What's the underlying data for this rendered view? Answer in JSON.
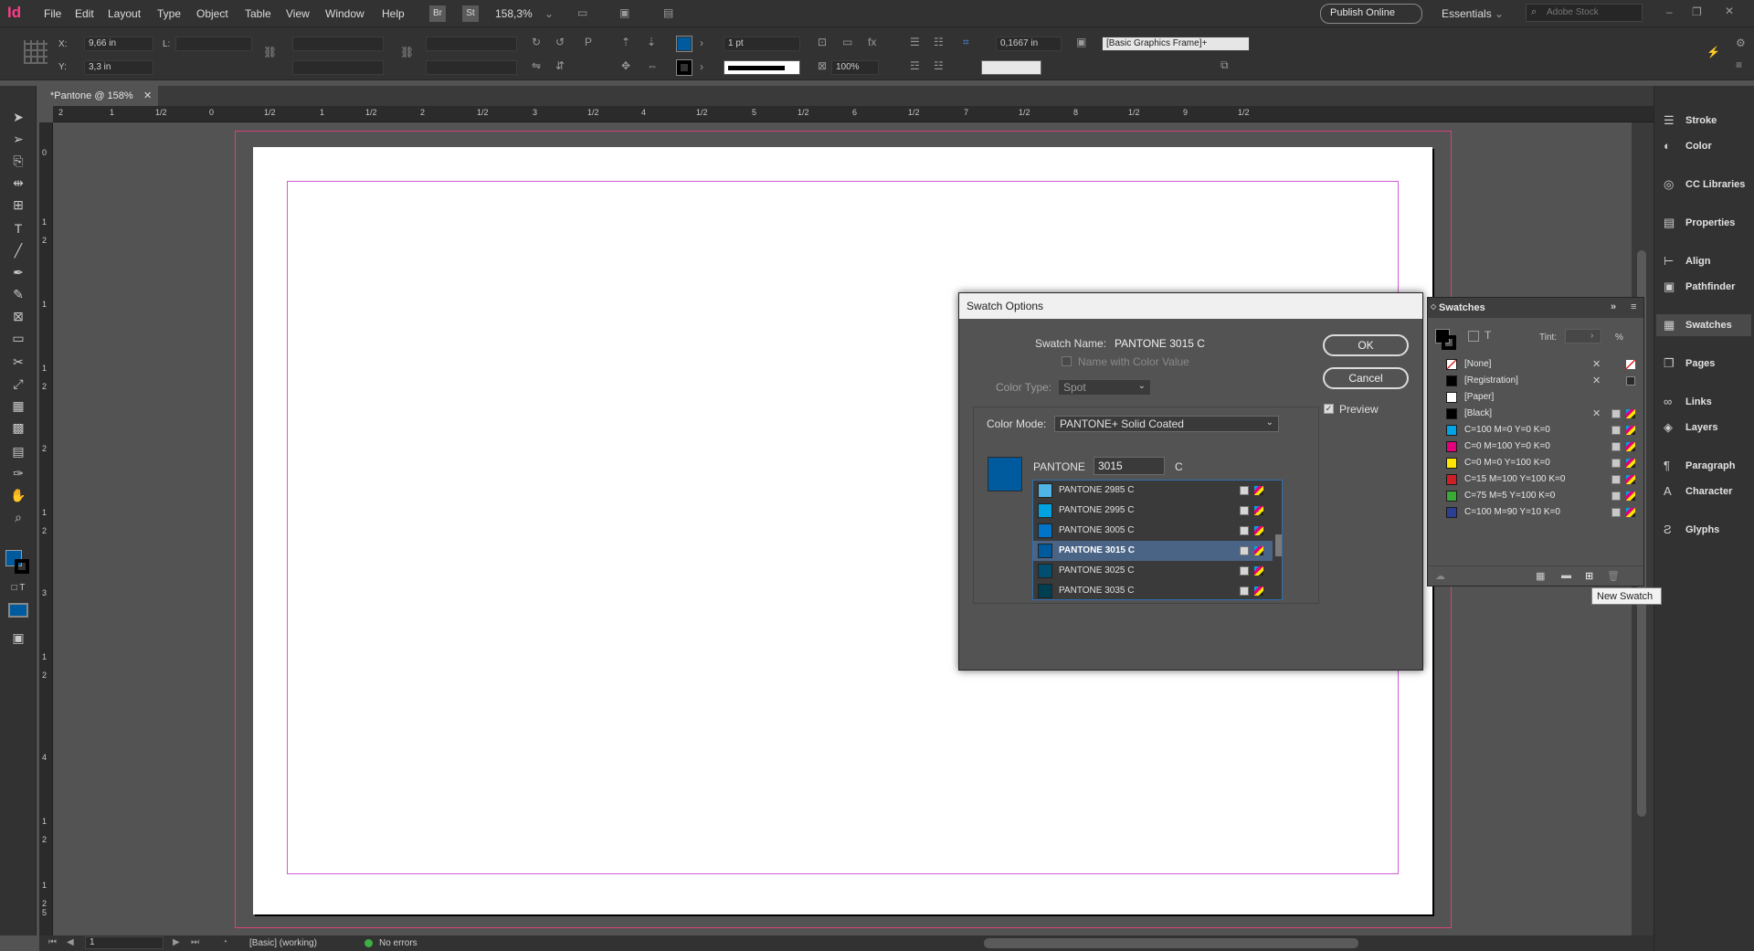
{
  "app": {
    "logo": "Id"
  },
  "menu": [
    "File",
    "Edit",
    "Layout",
    "Type",
    "Object",
    "Table",
    "View",
    "Window",
    "Help"
  ],
  "menubar": {
    "br": "Br",
    "st": "St",
    "zoom": "158,3%",
    "publish_online": "Publish Online",
    "workspace": "Essentials",
    "search_placeholder": "Adobe Stock"
  },
  "control": {
    "x_label": "X:",
    "x_value": "9,66 in",
    "y_label": "Y:",
    "y_value": "3,3 in",
    "l_label": "L:",
    "stroke_weight": "1 pt",
    "scale": "100%",
    "offset": "0,1667 in",
    "object_style": "[Basic Graphics Frame]+",
    "fill_color": "#005b9e",
    "stroke_color": "#000000"
  },
  "document_tab": {
    "title": "*Pantone @ 158%"
  },
  "hruler_labels": [
    "2",
    "1",
    "1/2",
    "0",
    "1/2",
    "1",
    "1/2",
    "2",
    "1/2",
    "3",
    "1/2",
    "4",
    "1/2",
    "5",
    "1/2",
    "6",
    "1/2",
    "7",
    "1/2",
    "8",
    "1/2",
    "9",
    "1/2"
  ],
  "vruler_labels": [
    "0",
    "1",
    "2",
    "1",
    "1",
    "2",
    "2",
    "1",
    "2",
    "3",
    "1",
    "2",
    "4",
    "1",
    "2",
    "5",
    "1",
    "2"
  ],
  "right_panels": [
    {
      "label": "Stroke",
      "icon": "stroke-icon",
      "glyph": "☰"
    },
    {
      "label": "Color",
      "icon": "color-icon",
      "glyph": "◐"
    },
    {
      "label": "CC Libraries",
      "icon": "cc-libraries-icon",
      "glyph": "◎"
    },
    {
      "label": "Properties",
      "icon": "properties-icon",
      "glyph": "▤"
    },
    {
      "label": "Align",
      "icon": "align-icon",
      "glyph": "⊢"
    },
    {
      "label": "Pathfinder",
      "icon": "pathfinder-icon",
      "glyph": "▣"
    },
    {
      "label": "Swatches",
      "icon": "swatches-icon",
      "glyph": "▦"
    },
    {
      "label": "Pages",
      "icon": "pages-icon",
      "glyph": "❐"
    },
    {
      "label": "Links",
      "icon": "links-icon",
      "glyph": "∞"
    },
    {
      "label": "Layers",
      "icon": "layers-icon",
      "glyph": "◈"
    },
    {
      "label": "Paragraph",
      "icon": "paragraph-icon",
      "glyph": "¶"
    },
    {
      "label": "Character",
      "icon": "character-icon",
      "glyph": "A"
    },
    {
      "label": "Glyphs",
      "icon": "glyphs-icon",
      "glyph": "Ƨ"
    }
  ],
  "dialog": {
    "title": "Swatch Options",
    "swatch_name_label": "Swatch Name:",
    "swatch_name_value": "PANTONE 3015 C",
    "name_with_color_value": "Name with Color Value",
    "color_type_label": "Color Type:",
    "color_type_value": "Spot",
    "color_mode_label": "Color Mode:",
    "color_mode_value": "PANTONE+ Solid Coated",
    "pantone_label": "PANTONE",
    "pantone_input": "3015",
    "pantone_suffix": "C",
    "preview_color": "#005b9e",
    "ok": "OK",
    "cancel": "Cancel",
    "preview": "Preview",
    "pantone_list": [
      {
        "name": "PANTONE 2985 C",
        "color": "#4fb5e6"
      },
      {
        "name": "PANTONE 2995 C",
        "color": "#00a3e0"
      },
      {
        "name": "PANTONE 3005 C",
        "color": "#0074c8"
      },
      {
        "name": "PANTONE 3015 C",
        "color": "#005b9e"
      },
      {
        "name": "PANTONE 3025 C",
        "color": "#004f71"
      },
      {
        "name": "PANTONE 3035 C",
        "color": "#003e51"
      }
    ]
  },
  "swatches": {
    "title": "Swatches",
    "tint_label": "Tint:",
    "tint_unit": "%",
    "items": [
      {
        "name": "[None]",
        "color": "#ffffff"
      },
      {
        "name": "[Registration]",
        "color": "#000000"
      },
      {
        "name": "[Paper]",
        "color": "#ffffff"
      },
      {
        "name": "[Black]",
        "color": "#000000"
      },
      {
        "name": "C=100 M=0 Y=0 K=0",
        "color": "#00a4e4"
      },
      {
        "name": "C=0 M=100 Y=0 K=0",
        "color": "#e4007c"
      },
      {
        "name": "C=0 M=0 Y=100 K=0",
        "color": "#ffe600"
      },
      {
        "name": "C=15 M=100 Y=100 K=0",
        "color": "#cc1f26"
      },
      {
        "name": "C=75 M=5 Y=100 K=0",
        "color": "#3aa935"
      },
      {
        "name": "C=100 M=90 Y=10 K=0",
        "color": "#2a3f93"
      }
    ]
  },
  "tooltip": "New Swatch",
  "status": {
    "page": "1",
    "preflight_profile": "[Basic] (working)",
    "errors": "No errors"
  }
}
